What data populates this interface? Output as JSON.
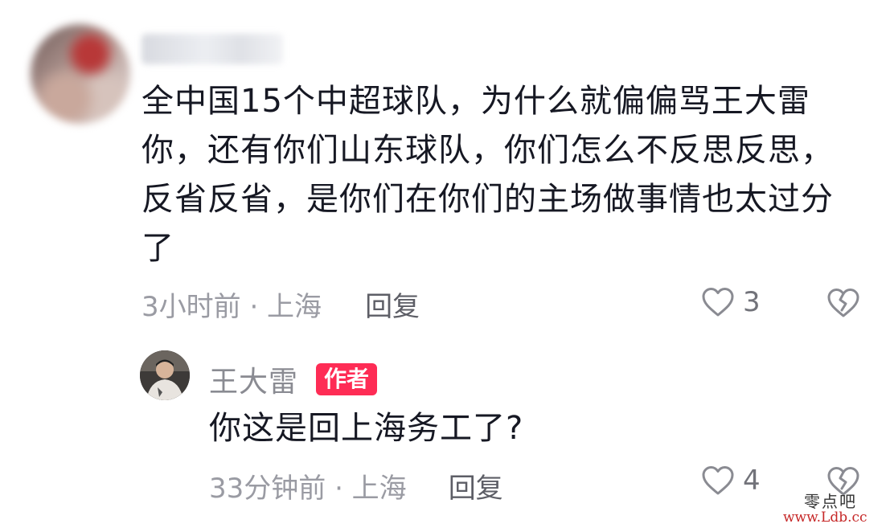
{
  "comment": {
    "text": "全中国15个中超球队，为什么就偏偏骂王大雷你，还有你们山东球队，你们怎么不反思反思，反省反省，是你们在你们的主场做事情也太过分了",
    "meta": "3小时前 · 上海",
    "reply_label": "回复",
    "likes": "3"
  },
  "reply": {
    "author": "王大雷",
    "badge": "作者",
    "text": "你这是回上海务工了?",
    "meta": "33分钟前 · 上海",
    "reply_label": "回复",
    "likes": "4"
  },
  "watermark": {
    "name": "零点吧",
    "url": "www.Ldb.cc"
  },
  "colors": {
    "accent": "#fe2c55",
    "meta_text": "#9a9ba3",
    "body_text": "#161823"
  },
  "icons": {
    "like": "heart-outline-icon",
    "dislike": "broken-heart-icon"
  }
}
